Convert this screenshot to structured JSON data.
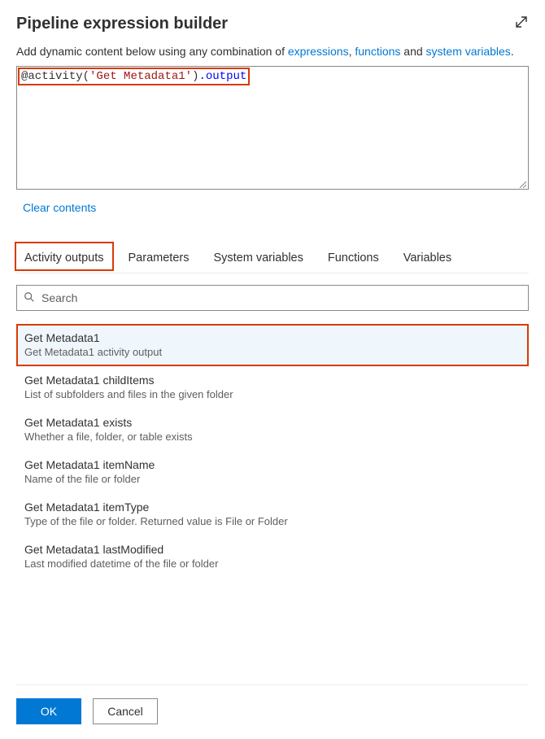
{
  "header": {
    "title": "Pipeline expression builder",
    "subtitle_prefix": "Add dynamic content below using any combination of ",
    "link_expressions": "expressions",
    "link_functions": "functions",
    "sep_comma": ", ",
    "sep_and": " and ",
    "link_sysvars": "system variables",
    "period": "."
  },
  "editor": {
    "at": "@",
    "fn_open": "activity(",
    "str": "'Get Metadata1'",
    "fn_close": ")",
    "dot_output": ".output",
    "full_value": "@activity('Get Metadata1').output"
  },
  "actions": {
    "clear": "Clear contents"
  },
  "tabs": [
    {
      "label": "Activity outputs",
      "active": true
    },
    {
      "label": "Parameters",
      "active": false
    },
    {
      "label": "System variables",
      "active": false
    },
    {
      "label": "Functions",
      "active": false
    },
    {
      "label": "Variables",
      "active": false
    }
  ],
  "search": {
    "placeholder": "Search"
  },
  "outputs": [
    {
      "title": "Get Metadata1",
      "desc": "Get Metadata1 activity output",
      "selected": true
    },
    {
      "title": "Get Metadata1 childItems",
      "desc": "List of subfolders and files in the given folder",
      "selected": false
    },
    {
      "title": "Get Metadata1 exists",
      "desc": "Whether a file, folder, or table exists",
      "selected": false
    },
    {
      "title": "Get Metadata1 itemName",
      "desc": "Name of the file or folder",
      "selected": false
    },
    {
      "title": "Get Metadata1 itemType",
      "desc": "Type of the file or folder. Returned value is File or Folder",
      "selected": false
    },
    {
      "title": "Get Metadata1 lastModified",
      "desc": "Last modified datetime of the file or folder",
      "selected": false
    }
  ],
  "footer": {
    "ok": "OK",
    "cancel": "Cancel"
  },
  "colors": {
    "highlight_border": "#d83b01",
    "link": "#0078d4",
    "primary": "#0078d4",
    "selected_bg": "#eff6fc"
  }
}
